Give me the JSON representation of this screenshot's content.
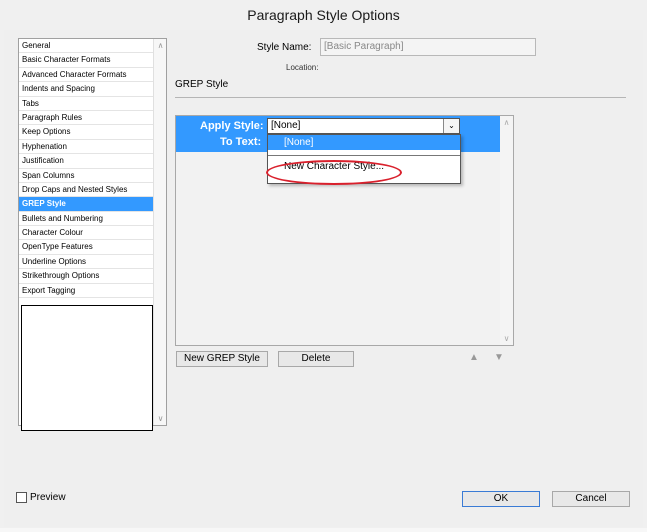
{
  "window": {
    "title": "Paragraph Style Options"
  },
  "header": {
    "style_name_label": "Style Name:",
    "style_name_value": "[Basic Paragraph]",
    "location_label": "Location:"
  },
  "sidebar": {
    "items": [
      "General",
      "Basic Character Formats",
      "Advanced Character Formats",
      "Indents and Spacing",
      "Tabs",
      "Paragraph Rules",
      "Keep Options",
      "Hyphenation",
      "Justification",
      "Span Columns",
      "Drop Caps and Nested Styles",
      "GREP Style",
      "Bullets and Numbering",
      "Character Colour",
      "OpenType Features",
      "Underline Options",
      "Strikethrough Options",
      "Export Tagging"
    ],
    "selected_index": 11
  },
  "section": {
    "title": "GREP Style"
  },
  "grep_rule": {
    "apply_style_label": "Apply Style:",
    "apply_style_value": "[None]",
    "to_text_label": "To Text:"
  },
  "dropdown": {
    "options": [
      "[None]"
    ],
    "new_style_option": "New Character Style..."
  },
  "buttons": {
    "new_grep_style": "New GREP Style",
    "delete": "Delete",
    "ok": "OK",
    "cancel": "Cancel"
  },
  "preview": {
    "label": "Preview",
    "checked": false
  },
  "colors": {
    "selection_blue": "#3399ff",
    "annotation_red": "#d9202c"
  }
}
